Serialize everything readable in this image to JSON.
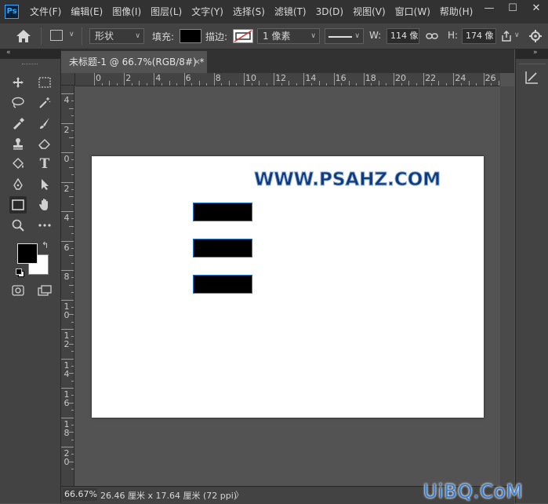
{
  "menubar": {
    "logo": "Ps",
    "items": [
      "文件(F)",
      "编辑(E)",
      "图像(I)",
      "图层(L)",
      "文字(Y)",
      "选择(S)",
      "滤镜(T)",
      "3D(D)",
      "视图(V)",
      "窗口(W)",
      "帮助(H)"
    ],
    "window_controls": [
      "—",
      "☐",
      "✕"
    ]
  },
  "options": {
    "mode": "形状",
    "fill_label": "填充:",
    "stroke_label": "描边:",
    "stroke_width": "1 像素",
    "w_label": "W:",
    "w_value": "114 像",
    "link_icon": "link-icon",
    "h_label": "H:",
    "h_value": "174 像"
  },
  "tab": {
    "title": "未标题-1 @ 66.7%(RGB/8#) *",
    "close": "×"
  },
  "hruler": {
    "labels": [
      "0",
      "2",
      "4",
      "6",
      "8",
      "10",
      "12",
      "14",
      "16",
      "18",
      "20",
      "22",
      "24",
      "26"
    ]
  },
  "vruler": {
    "labels": [
      "4",
      "2",
      "0",
      "2",
      "4",
      "6",
      "8",
      "10",
      "12",
      "14",
      "16",
      "18",
      "20"
    ]
  },
  "canvas": {
    "watermark_text": "WWW.PSAHZ.COM",
    "rect_fill": "#000000",
    "rect_stroke": "#1e78c8"
  },
  "status": {
    "zoom": "66.67%",
    "doc_info": "26.46 厘米 x 17.64 厘米 (72 ppi)",
    "arrow": "〉"
  },
  "site_mark": "UiBQ.CoM",
  "colors": {
    "foreground": "#000000",
    "background": "#ffffff",
    "accent": "#31a8ff"
  }
}
